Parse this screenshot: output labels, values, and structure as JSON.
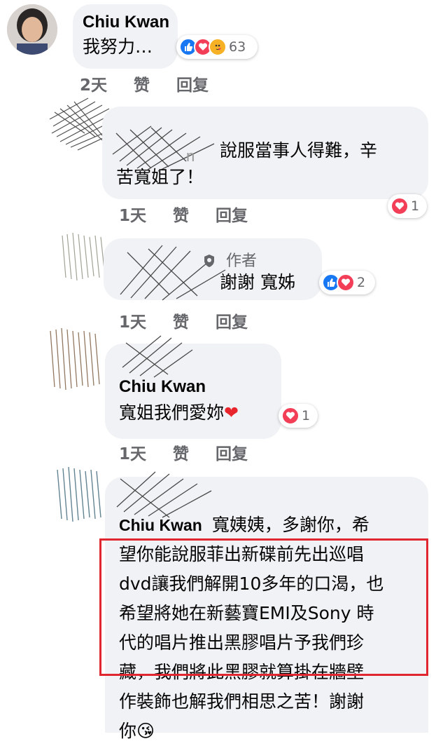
{
  "comments": [
    {
      "author": "Chiu Kwan",
      "text": "我努力…",
      "time": "2天",
      "like_label": "赞",
      "reply_label": "回复",
      "reaction_count": "63",
      "reactions": [
        "like-icon",
        "love-icon",
        "care-icon"
      ]
    },
    {
      "author": "",
      "text_line1": "說服當事人得難，辛",
      "text_line2": "苦寬姐了！",
      "time": "1天",
      "like_label": "赞",
      "reply_label": "回复",
      "reaction_count": "1",
      "reactions": [
        "love-icon"
      ]
    },
    {
      "author": "",
      "author_badge": "作者",
      "text": "謝謝 寬姊",
      "time": "1天",
      "like_label": "赞",
      "reply_label": "回复",
      "reaction_count": "2",
      "reactions": [
        "like-icon",
        "love-icon"
      ]
    },
    {
      "author": "Chiu Kwan",
      "text": "寬姐我們愛妳",
      "emoji": "❤",
      "time": "1天",
      "like_label": "赞",
      "reply_label": "回复",
      "reaction_count": "1",
      "reactions": [
        "love-icon"
      ]
    },
    {
      "author": "Chiu Kwan",
      "lines": [
        "寬姨姨，多謝你，希",
        "望你能說服菲出新碟前先出巡唱",
        "dvd讓我們解開10多年的口渴，也",
        "希望將她在新藝寶EMI及Sony 時",
        "代的唱片推出黑膠唱片予我們珍",
        "藏，我們將此黑膠就算掛在牆壁",
        "作裝飾也解我們相思之苦！謝謝",
        "你"
      ],
      "emoji": "😘"
    }
  ],
  "colors": {
    "bubble": "#f0f2f5",
    "highlight": "#e0262e",
    "like": "#1877f2",
    "love": "#f33e58"
  }
}
